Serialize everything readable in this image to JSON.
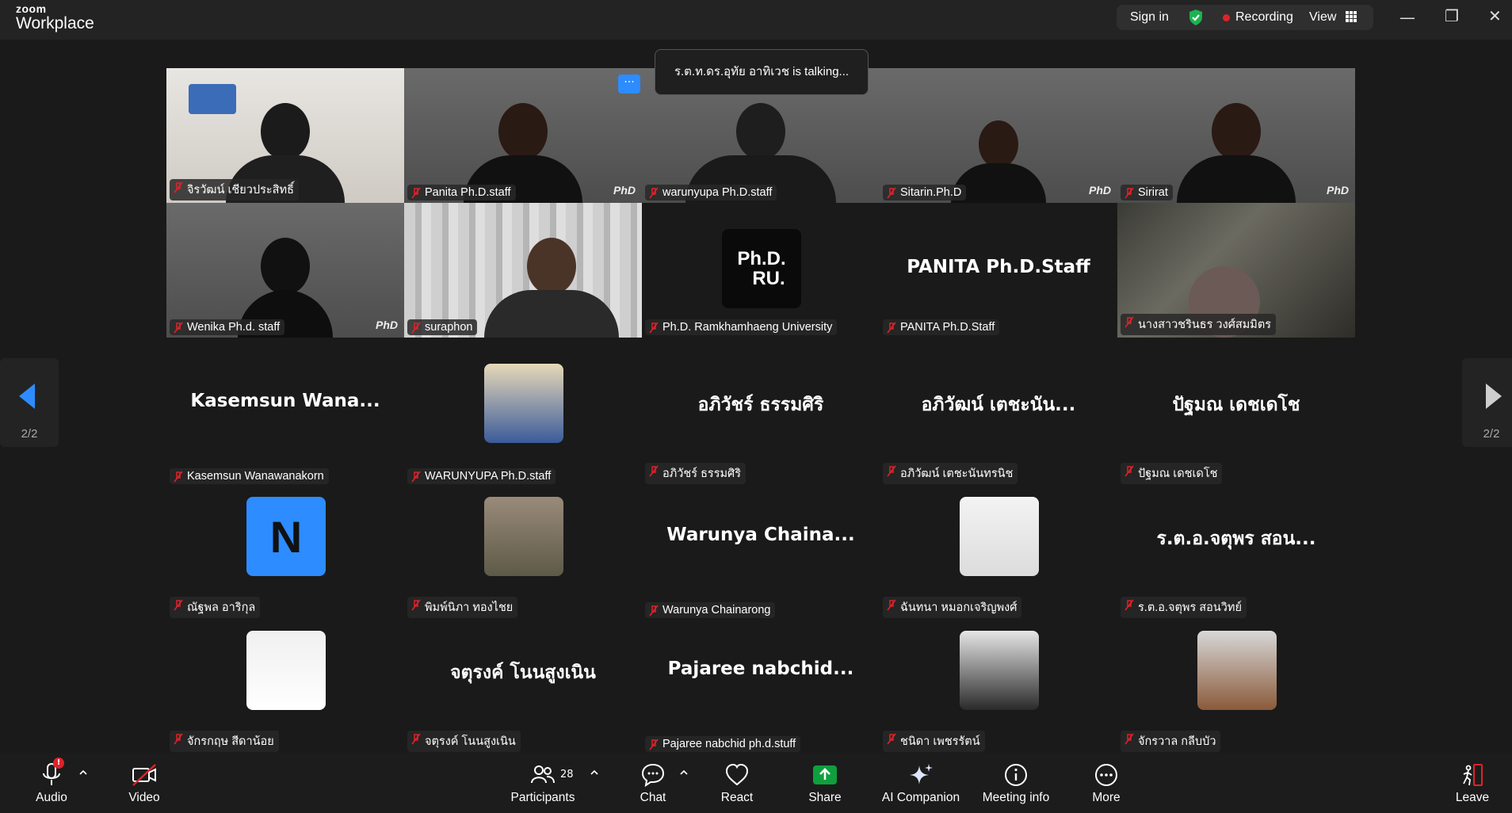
{
  "app": {
    "brand_small": "zoom",
    "brand_large": "Workplace"
  },
  "top": {
    "sign_in": "Sign in",
    "recording": "Recording",
    "view": "View"
  },
  "talking": "ร.ต.ท.ดร.อุทัย อาทิเวช is talking...",
  "video_tiles": [
    {
      "name": "จิรวัฒน์ เชียวประสิทธิ์"
    },
    {
      "name": "Panita Ph.D.staff"
    },
    {
      "name": "warunyupa Ph.D.staff"
    },
    {
      "name": "Sitarin.Ph.D"
    },
    {
      "name": "Sirirat"
    },
    {
      "name": "Wenika Ph.d. staff"
    },
    {
      "name": "suraphon"
    },
    {
      "name": "Ph.D. Ramkhamhaeng University",
      "avatar_text_1": "Ph.D.",
      "avatar_text_2": "RU."
    },
    {
      "name": "PANITA Ph.D.Staff",
      "big": "PANITA Ph.D.Staff"
    },
    {
      "name": "นางสาวชรินธร วงศ์สมมิตร"
    }
  ],
  "tiles": [
    {
      "big": "Kasemsun  Wana...",
      "name": "Kasemsun Wanawanakorn"
    },
    {
      "name": "WARUNYUPA Ph.D.staff"
    },
    {
      "big": "อภิวัชร์ ธรรมศิริ",
      "name": "อภิวัชร์ ธรรมศิริ"
    },
    {
      "big": "อภิวัฒน์ เตชะนัน...",
      "name": "อภิวัฒน์ เตชะนันทรนิช"
    },
    {
      "big": "ปัฐมณ เดชเดโช",
      "name": "ปัฐมณ เดชเดโช"
    },
    {
      "name": "ณัฐพล อาริกุล",
      "avatar_letter": "N"
    },
    {
      "name": "พิมพ์นิภา ทองไชย"
    },
    {
      "big": "Warunya  Chaina...",
      "name": "Warunya Chainarong"
    },
    {
      "name": "ฉันทนา หมอกเจริญพงศ์"
    },
    {
      "big": "ร.ต.อ.จตุพร  สอน...",
      "name": "ร.ต.อ.จตุพร  สอนวิทย์"
    },
    {
      "name": "จักรกฤษ สีดาน้อย"
    },
    {
      "big": "จตุรงค์ โนนสูงเนิน",
      "name": "จตุรงค์ โนนสูงเนิน"
    },
    {
      "big": "Pajaree  nabchid...",
      "name": "Pajaree nabchid ph.d.stuff"
    },
    {
      "name": "ชนิดา เพชรรัตน์"
    },
    {
      "name": "จักรวาล กลีบบัว"
    }
  ],
  "pager": {
    "left": "2/2",
    "right": "2/2"
  },
  "toolbar": {
    "audio": "Audio",
    "video": "Video",
    "participants": "Participants",
    "participants_count": "28",
    "chat": "Chat",
    "react": "React",
    "share": "Share",
    "ai": "AI Companion",
    "meeting_info": "Meeting info",
    "more": "More",
    "leave": "Leave",
    "audio_badge": "!"
  },
  "colors": {
    "accent": "#2d8cff",
    "share": "#0e9f3e",
    "record": "#e0222a",
    "leave": "#e0222a"
  }
}
